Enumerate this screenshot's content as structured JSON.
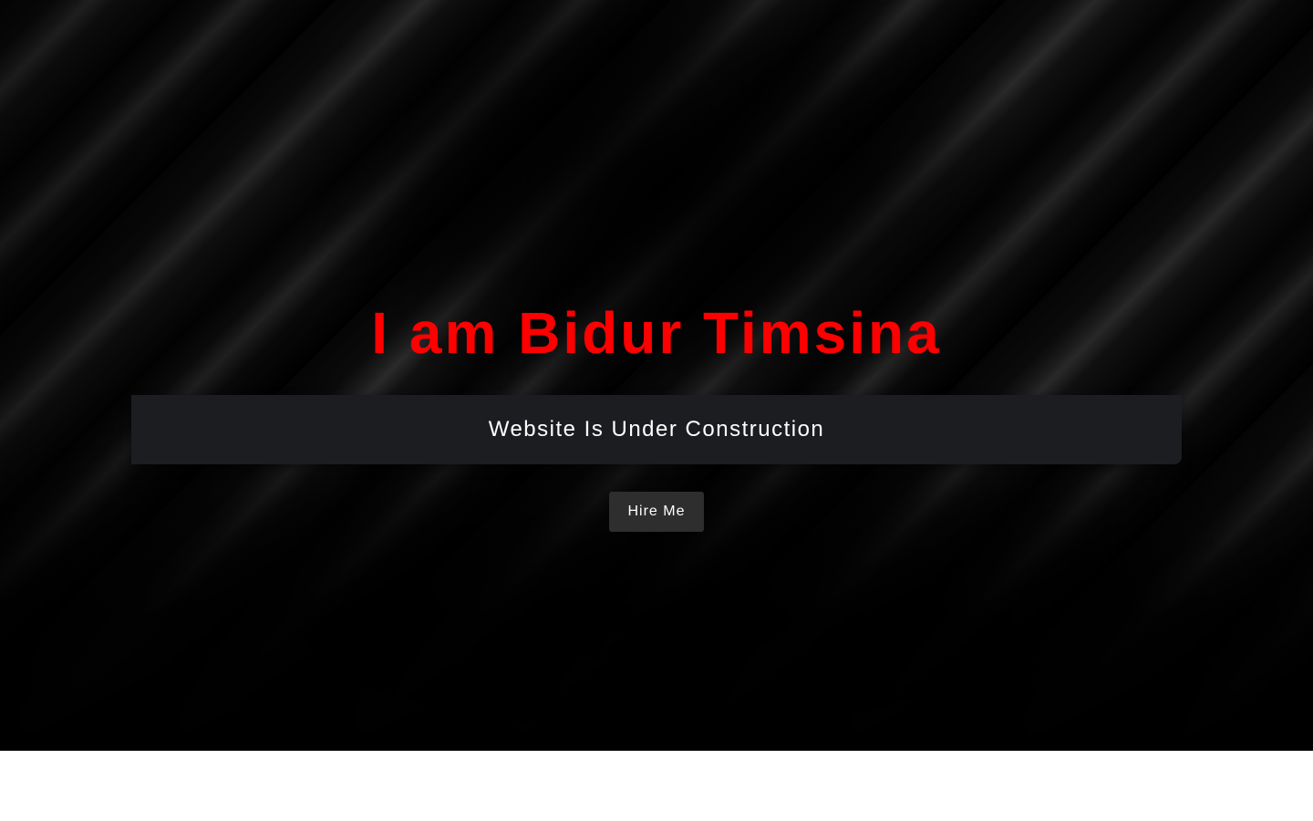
{
  "hero": {
    "title": "I am Bidur Timsina",
    "subtitle": "Website Is Under Construction",
    "button_label": "Hire Me"
  },
  "colors": {
    "title": "#ff0000",
    "subtitle_bg": "#1c1d20",
    "button_bg": "#2e2e2e",
    "text": "#ffffff",
    "page_bg": "#ffffff"
  }
}
